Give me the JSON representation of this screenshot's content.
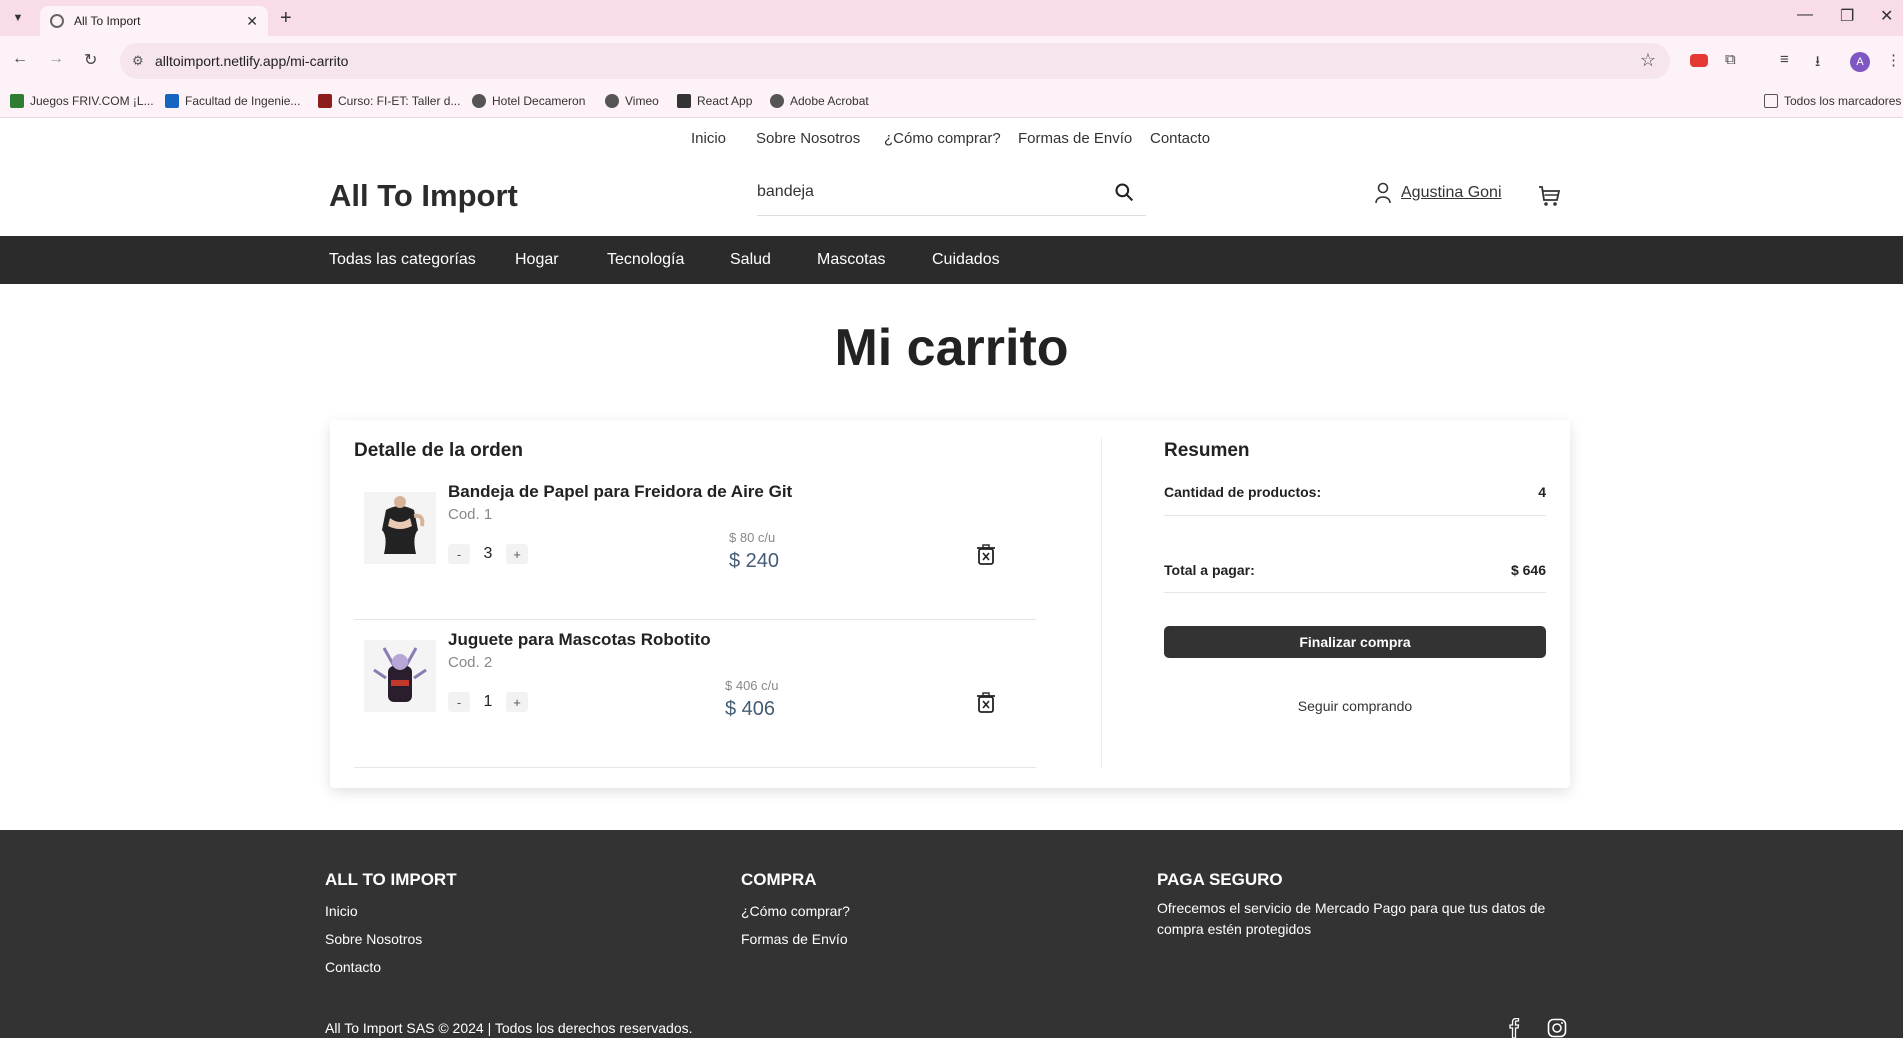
{
  "browser": {
    "tab_title": "All To Import",
    "url": "alltoimport.netlify.app/mi-carrito",
    "profile_initial": "A",
    "bookmarks": [
      "Juegos FRIV.COM ¡L...",
      "Facultad de Ingenie...",
      "Curso: FI-ET: Taller d...",
      "Hotel Decameron",
      "Vimeo",
      "React App",
      "Adobe Acrobat"
    ],
    "all_bookmarks": "Todos los marcadores"
  },
  "topnav": [
    "Inicio",
    "Sobre Nosotros",
    "¿Cómo comprar?",
    "Formas de Envío",
    "Contacto"
  ],
  "header": {
    "logo": "All To Import",
    "search_value": "bandeja",
    "user_name": "Agustina Goni"
  },
  "categories": [
    "Todas las categorías",
    "Hogar",
    "Tecnología",
    "Salud",
    "Mascotas",
    "Cuidados"
  ],
  "page_title": "Mi carrito",
  "order": {
    "title": "Detalle de la orden",
    "items": [
      {
        "name": "Bandeja de Papel para Freidora de Aire Git",
        "code": "Cod. 1",
        "qty": "3",
        "unit_price": "$ 80 c/u",
        "total": "$ 240"
      },
      {
        "name": "Juguete para Mascotas Robotito",
        "code": "Cod. 2",
        "qty": "1",
        "unit_price": "$ 406 c/u",
        "total": "$ 406"
      }
    ],
    "minus": "-",
    "plus": "+"
  },
  "summary": {
    "title": "Resumen",
    "qty_label": "Cantidad de productos:",
    "qty_value": "4",
    "total_label": "Total a pagar:",
    "total_value": "$ 646",
    "finish_button": "Finalizar compra",
    "continue_link": "Seguir comprando"
  },
  "footer": {
    "col1_title": "ALL TO IMPORT",
    "col1_links": [
      "Inicio",
      "Sobre Nosotros",
      "Contacto"
    ],
    "col2_title": "COMPRA",
    "col2_links": [
      "¿Cómo comprar?",
      "Formas de Envío"
    ],
    "col3_title": "PAGA SEGURO",
    "col3_text_line1": "Ofrecemos el servicio de Mercado Pago para que tus datos de",
    "col3_text_line2": "compra estén protegidos",
    "copyright": "All To Import SAS © 2024 | Todos los derechos reservados."
  },
  "icons": [
    "search-icon",
    "user-icon",
    "cart-icon",
    "trash-icon",
    "facebook-icon",
    "instagram-icon"
  ],
  "colors": {
    "dark": "#333333",
    "price": "#445d75",
    "chrome": "#f9dce9"
  }
}
